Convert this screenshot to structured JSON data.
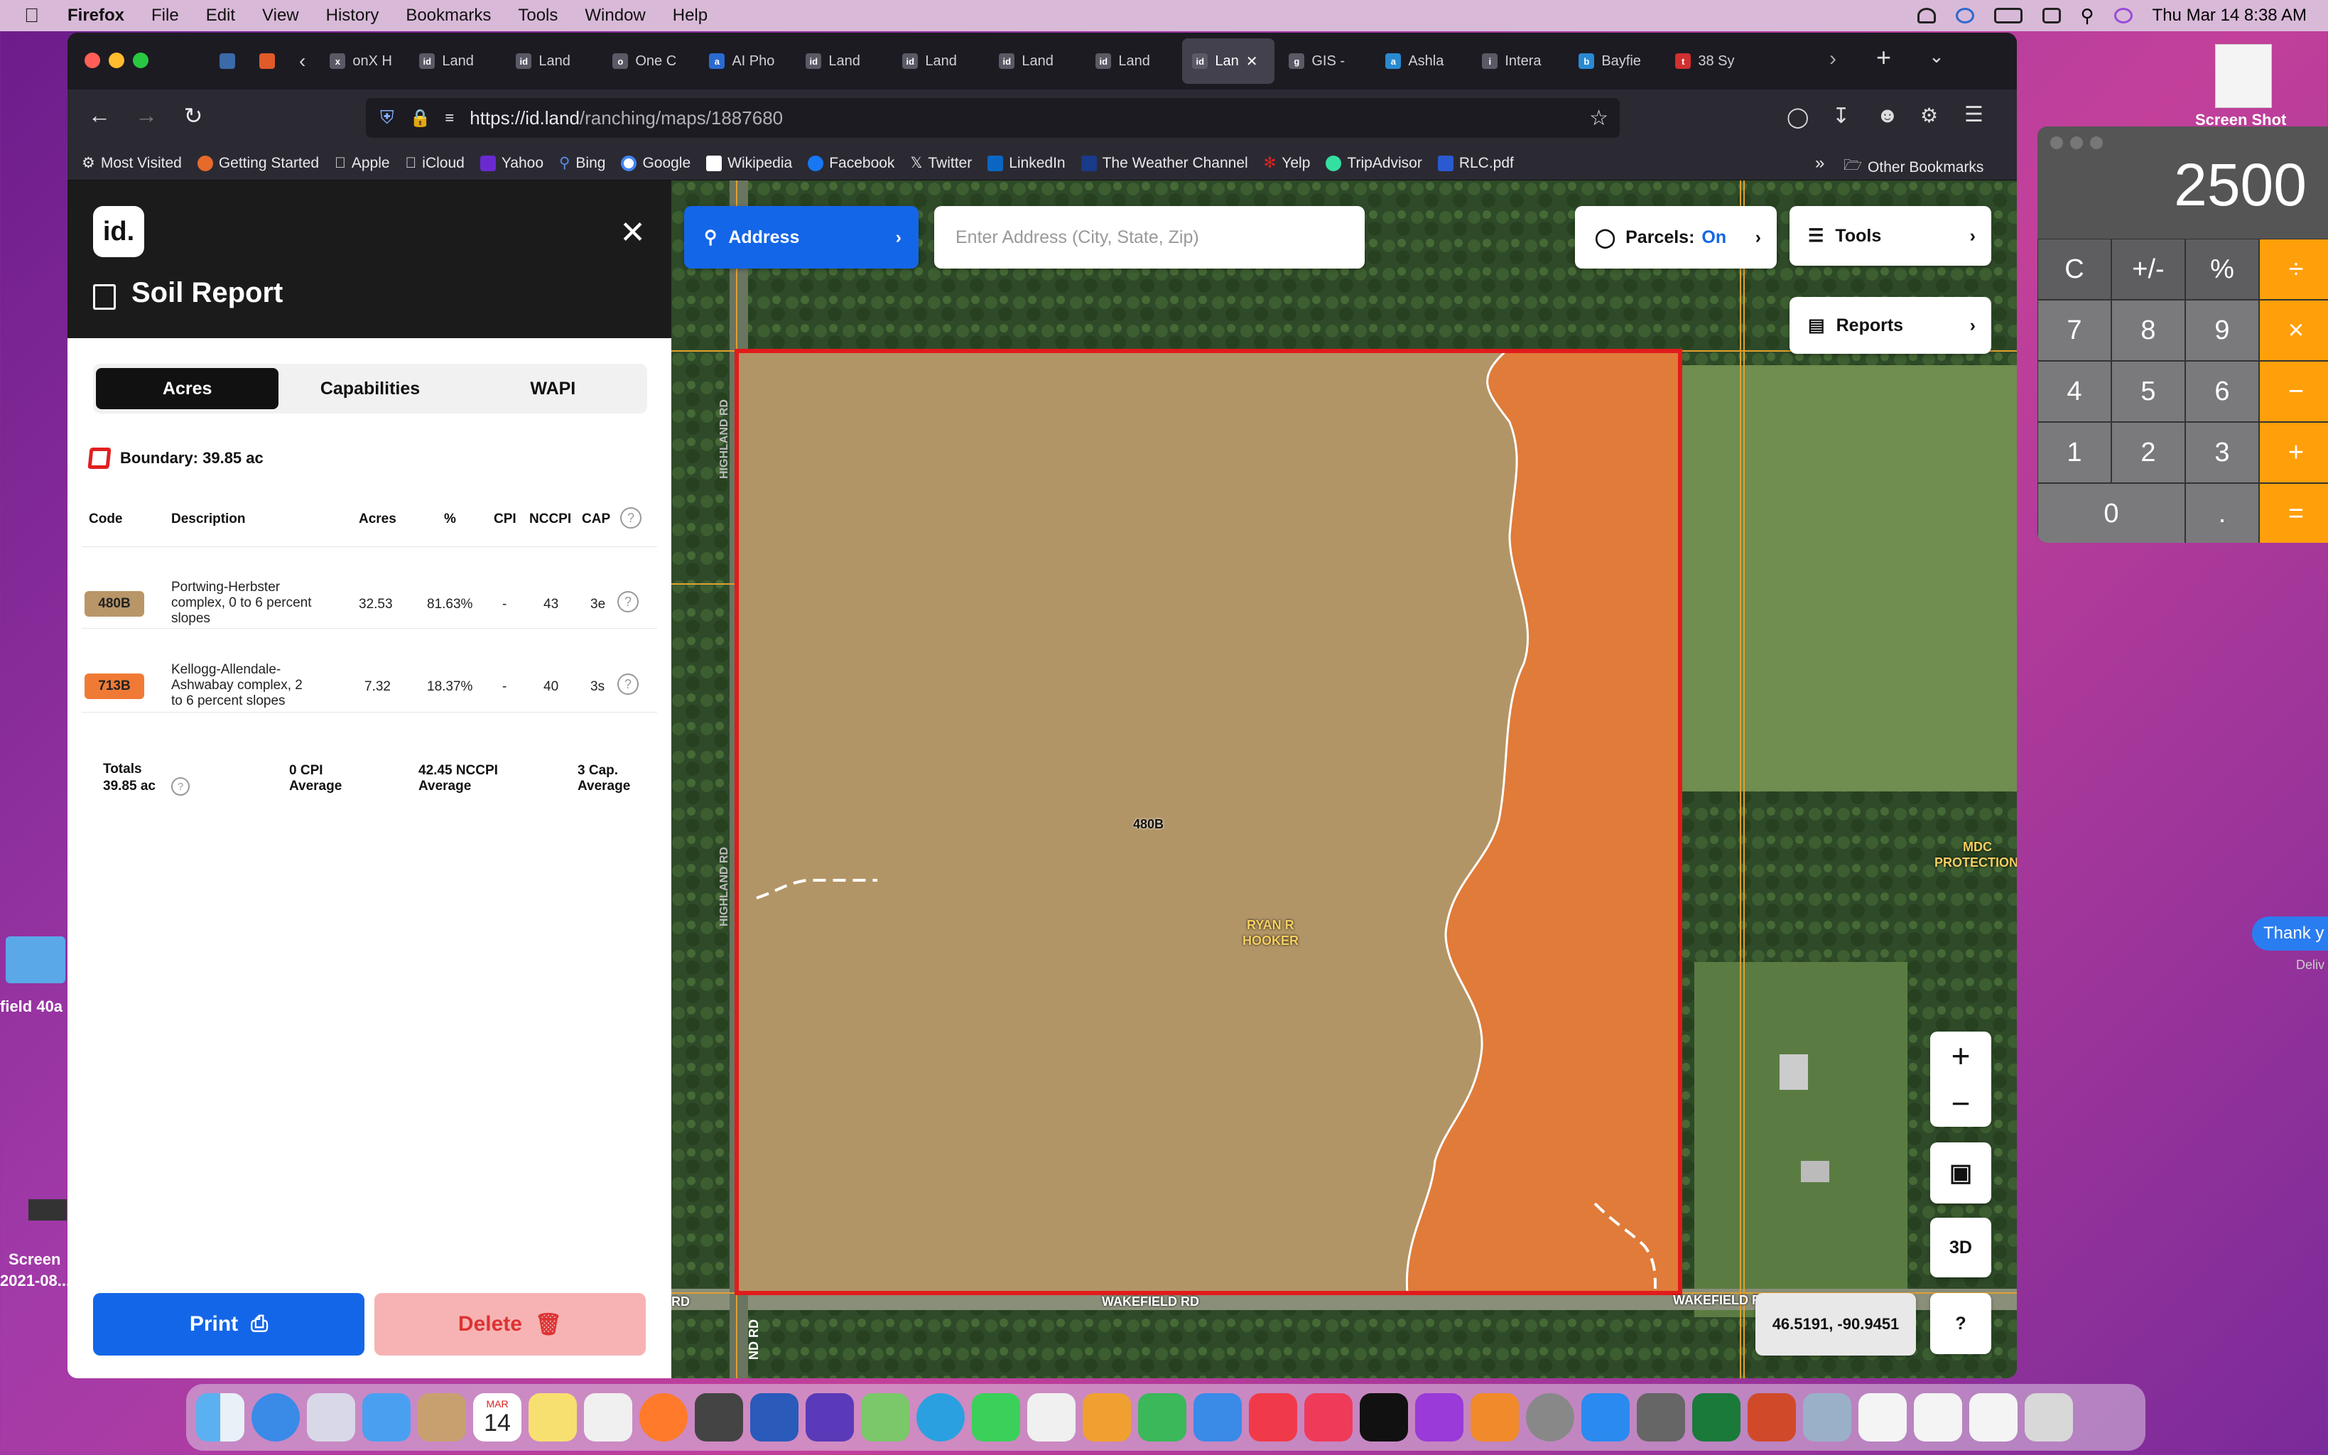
{
  "menubar": {
    "app": "Firefox",
    "items": [
      "File",
      "Edit",
      "View",
      "History",
      "Bookmarks",
      "Tools",
      "Window",
      "Help"
    ],
    "datetime": "Thu Mar 14  8:38 AM"
  },
  "browser": {
    "tabs": [
      {
        "label": "onX H",
        "icon": "x"
      },
      {
        "label": "Land",
        "icon": "id"
      },
      {
        "label": "Land",
        "icon": "id"
      },
      {
        "label": "One C",
        "icon": "o"
      },
      {
        "label": "AI Pho",
        "icon": "a"
      },
      {
        "label": "Land",
        "icon": "id"
      },
      {
        "label": "Land",
        "icon": "id"
      },
      {
        "label": "Land",
        "icon": "id"
      },
      {
        "label": "Land",
        "icon": "id"
      },
      {
        "label": "Lan",
        "icon": "id",
        "active": true
      },
      {
        "label": "GIS -",
        "icon": "g"
      },
      {
        "label": "Ashla",
        "icon": "a"
      },
      {
        "label": "Intera",
        "icon": "i"
      },
      {
        "label": "Bayfie",
        "icon": "b"
      },
      {
        "label": "38 Sy",
        "icon": "t"
      }
    ],
    "url_host": "https://id.land",
    "url_path": "/ranching/maps/1887680",
    "bookmarks": [
      "Most Visited",
      "Getting Started",
      "Apple",
      "iCloud",
      "Yahoo",
      "Bing",
      "Google",
      "Wikipedia",
      "Facebook",
      "Twitter",
      "LinkedIn",
      "The Weather Channel",
      "Yelp",
      "TripAdvisor",
      "RLC.pdf"
    ],
    "other_bookmarks": "Other Bookmarks"
  },
  "panel": {
    "logo": "id.",
    "title": "Soil Report",
    "tabs": [
      "Acres",
      "Capabilities",
      "WAPI"
    ],
    "boundary": "Boundary: 39.85 ac",
    "headers": {
      "code": "Code",
      "description": "Description",
      "acres": "Acres",
      "pct": "%",
      "cpi": "CPI",
      "nccpi": "NCCPI",
      "cap": "CAP"
    },
    "rows": [
      {
        "code": "480B",
        "desc1": "Portwing-Herbster",
        "desc2": "complex, 0 to 6 percent",
        "desc3": "slopes",
        "acres": "32.53",
        "pct": "81.63%",
        "cpi": "-",
        "nccpi": "43",
        "cap": "3e",
        "color": "#b99667"
      },
      {
        "code": "713B",
        "desc1": "Kellogg-Allendale-",
        "desc2": "Ashwabay complex, 2",
        "desc3": "to 6 percent slopes",
        "acres": "7.32",
        "pct": "18.37%",
        "cpi": "-",
        "nccpi": "40",
        "cap": "3s",
        "color": "#f07a35"
      }
    ],
    "totals": {
      "label": "Totals",
      "acres": "39.85 ac",
      "cpi1": "0 CPI",
      "cpi2": "Average",
      "nccpi1": "42.45 NCCPI",
      "nccpi2": "Average",
      "cap1": "3 Cap.",
      "cap2": "Average"
    },
    "print": "Print",
    "delete": "Delete"
  },
  "map": {
    "address_button": "Address",
    "address_placeholder": "Enter Address (City, State, Zip)",
    "parcels_label": "Parcels:",
    "parcels_state": "On",
    "tools": "Tools",
    "reports": "Reports",
    "labels": {
      "soil_code": "480B",
      "owner1": "RYAN R",
      "owner2": "HOOKER",
      "mdc1": "MDC",
      "mdc2": "PROTECTION",
      "road_w1": "HIGHLAND RD",
      "road_w2": "HIGHLAND RD",
      "road_s1": "WAKEFIELD RD",
      "road_s2": "WAKEFIELD RD",
      "road_s3": "RD",
      "road_s4": "ND RD"
    },
    "coords": "46.5191, -90.9451",
    "zoom_in": "+",
    "zoom_out": "−",
    "mode_3d": "3D",
    "help": "?"
  },
  "calculator": {
    "display": "2500",
    "keys": [
      "C",
      "+/-",
      "%",
      "÷",
      "7",
      "8",
      "9",
      "×",
      "4",
      "5",
      "6",
      "−",
      "1",
      "2",
      "3",
      "+",
      "0",
      ".",
      "="
    ]
  },
  "desktop": {
    "screenshot_label": "Screen Shot",
    "messages_bubble": "Thank y",
    "messages_status": "Deliv",
    "folder_label": "field 40a",
    "screen_label1": "Screen",
    "screen_label2": "2021-08...",
    "calendar_month": "MAR",
    "calendar_day": "14"
  }
}
